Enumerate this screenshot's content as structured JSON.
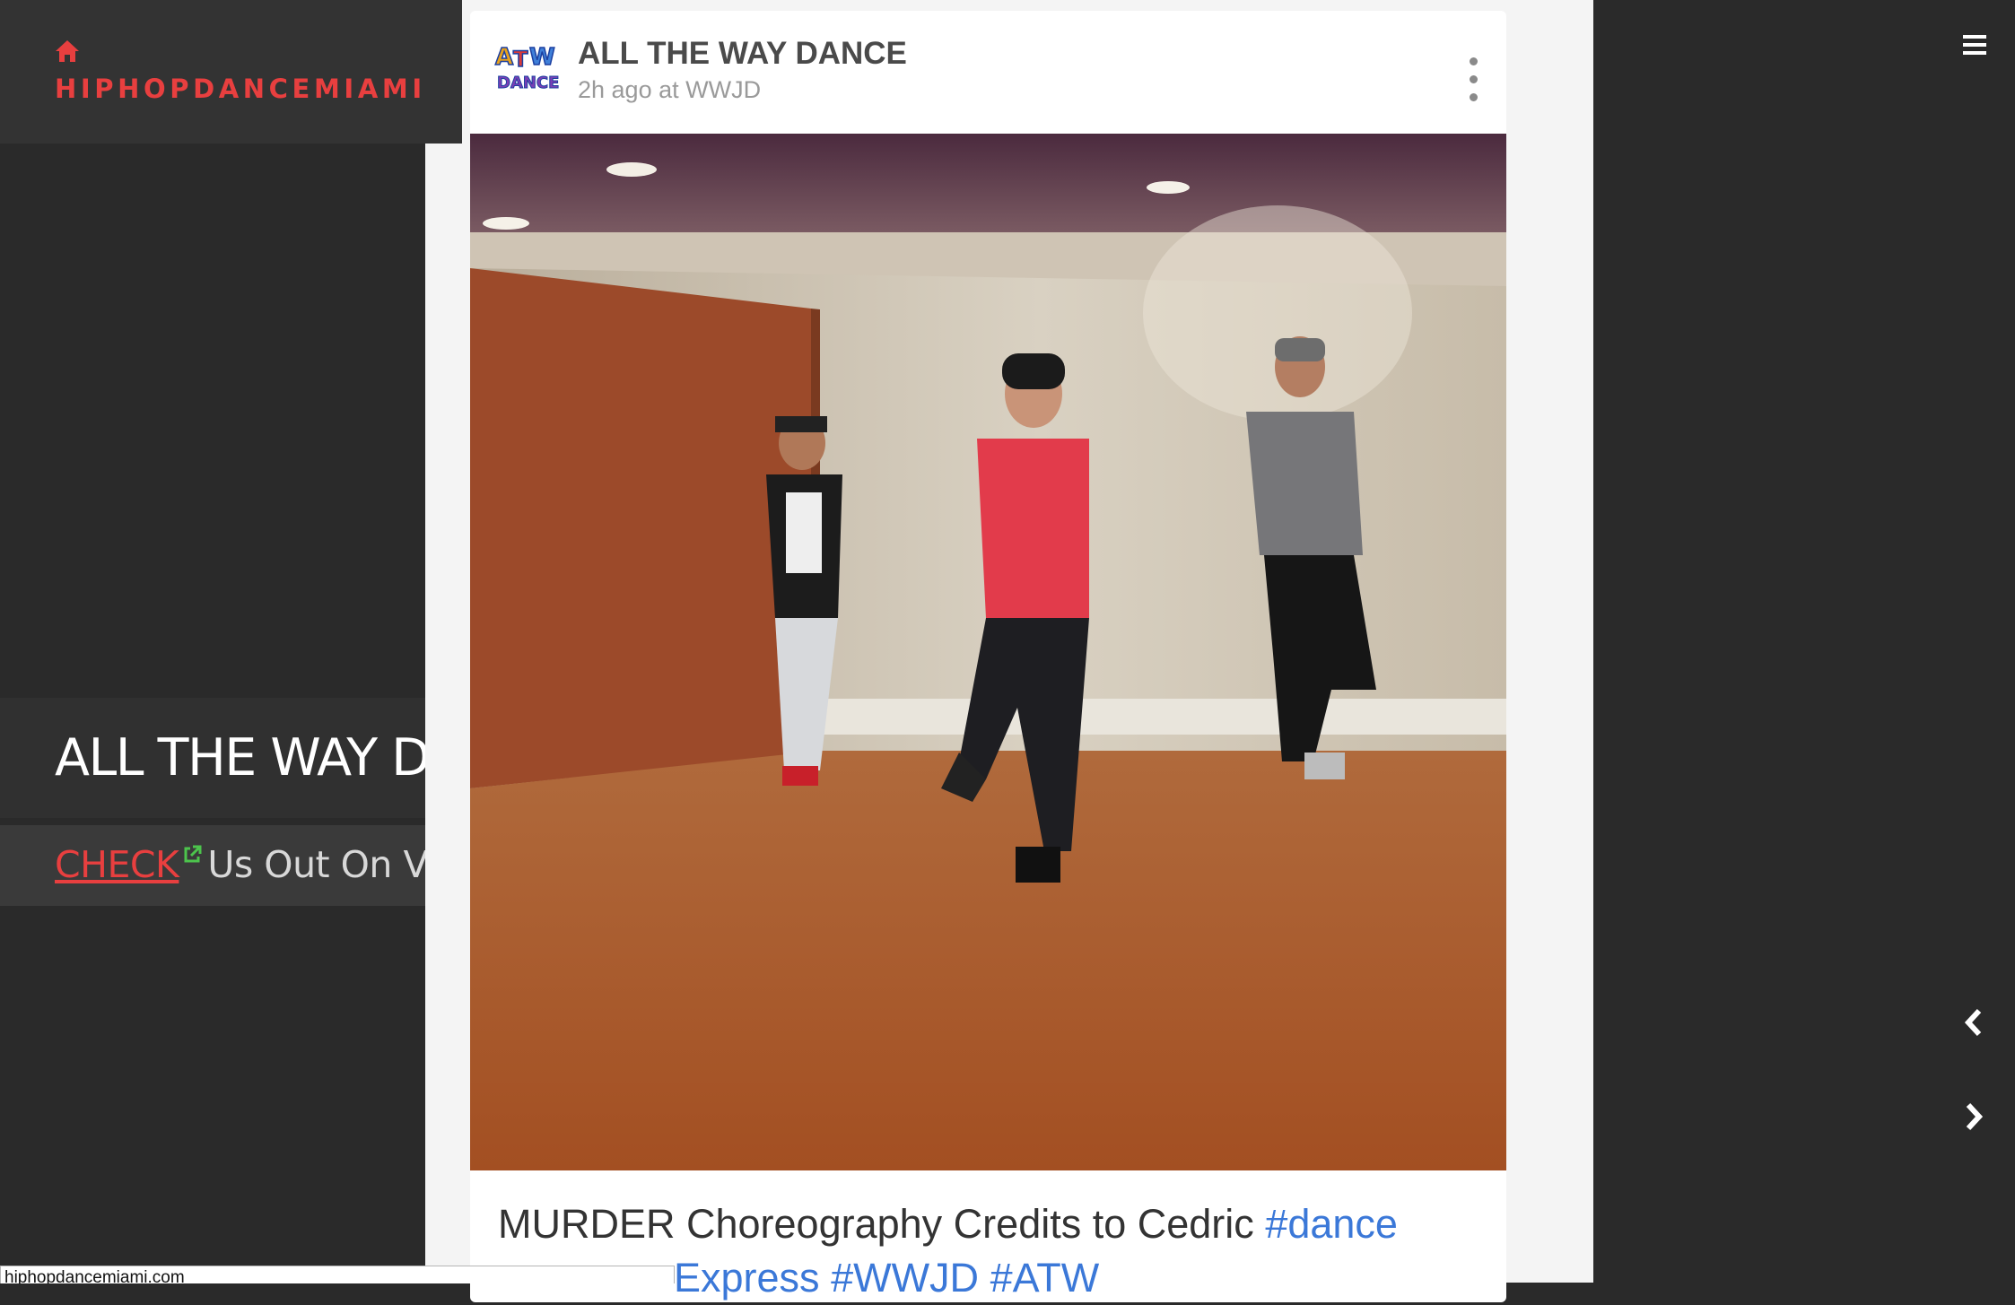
{
  "site": {
    "name": "HIPHOPDANCEMIAMI",
    "accent_color": "#e83f3f",
    "home_icon": "home-icon"
  },
  "sidebar": {
    "title": "ALL THE WAY DANCE",
    "vine": {
      "link_label": "CHECK",
      "rest_label": "Us Out On Vine!",
      "link_icon": "external-link-icon",
      "link_icon_color": "#4cc44c"
    }
  },
  "post": {
    "author": "ALL THE WAY DANCE",
    "meta": "2h ago at WWJD",
    "avatar_icon": "atw-dance-logo",
    "more_icon": "vertical-dots-icon",
    "caption": {
      "text": "MURDER Choreography Credits to Cedric",
      "tag1": "#dance",
      "line2_text": "Express",
      "tag2": "#WWJD",
      "tag3": "#ATW",
      "tag_color": "#3b78d8"
    }
  },
  "nav": {
    "menu_icon": "hamburger-menu-icon",
    "prev_icon": "chevron-left-icon",
    "next_icon": "chevron-right-icon"
  },
  "status_bar": {
    "url": "hiphopdancemiami.com"
  }
}
